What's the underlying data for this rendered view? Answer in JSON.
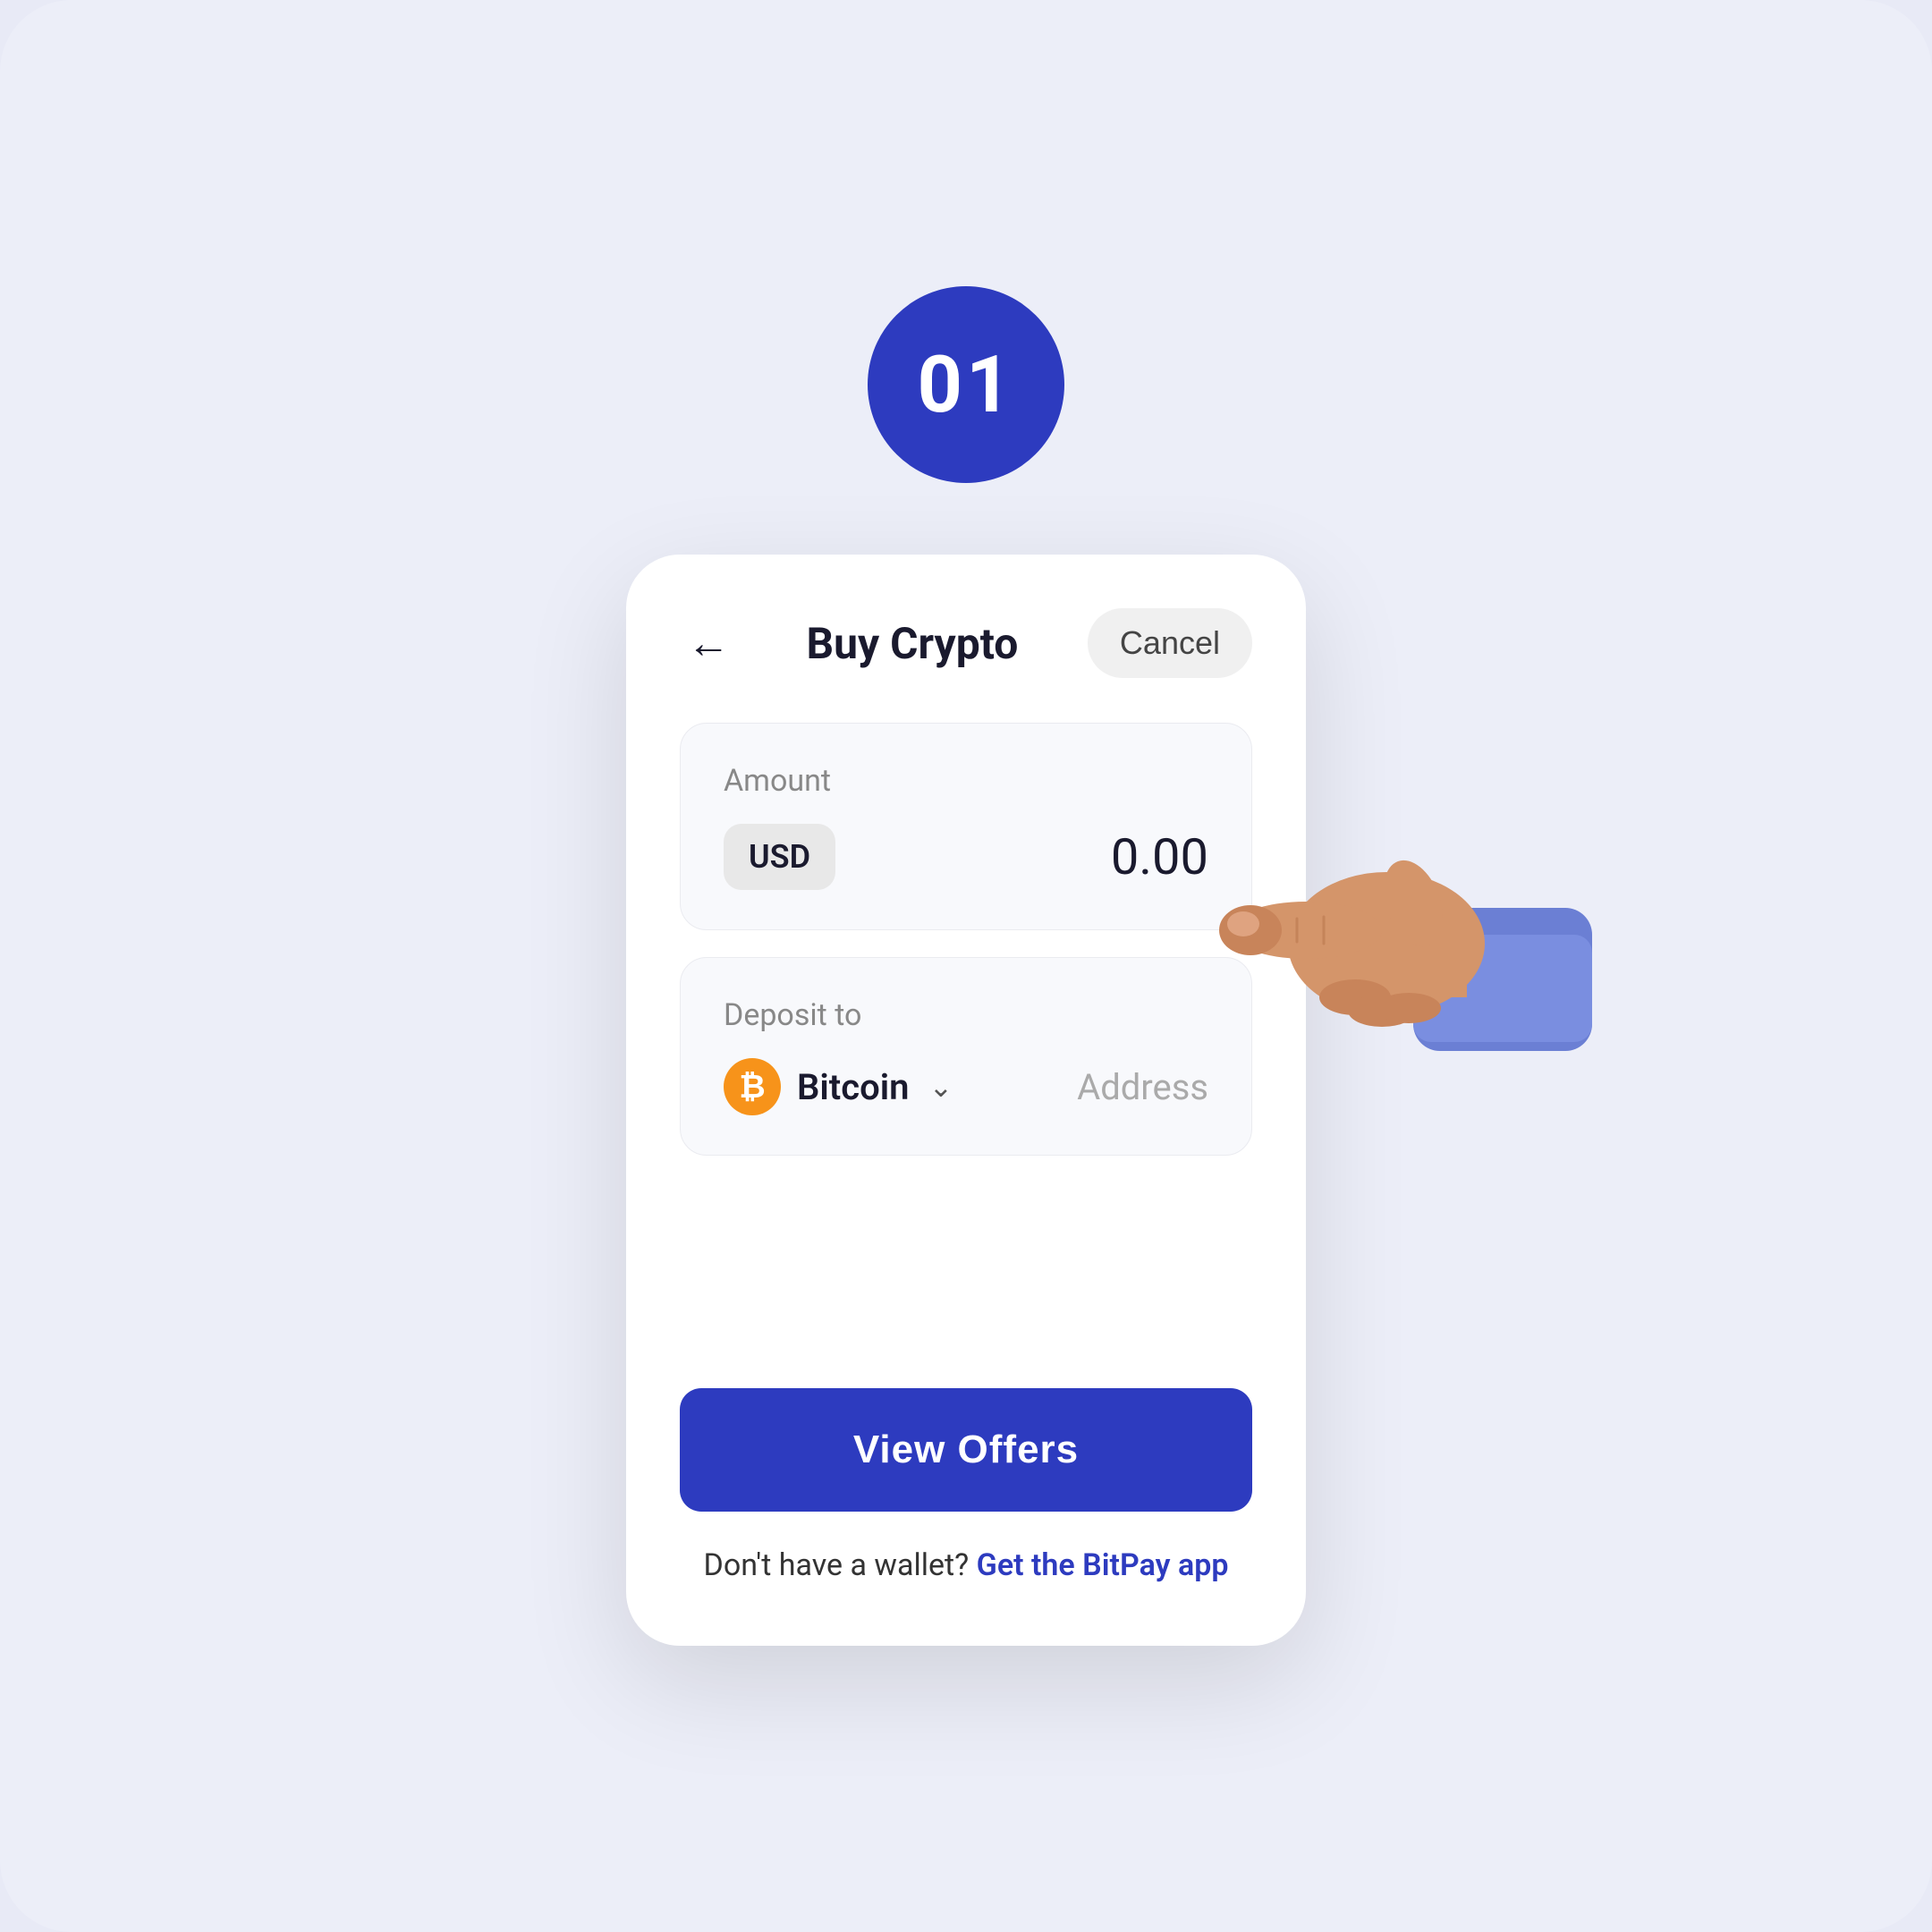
{
  "page": {
    "background_color": "#eceef8",
    "step_number": "01",
    "step_badge_color": "#2d3bbf"
  },
  "header": {
    "title": "Buy Crypto",
    "cancel_label": "Cancel",
    "back_icon": "←"
  },
  "amount_section": {
    "label": "Amount",
    "currency": "USD",
    "value": "0.00"
  },
  "deposit_section": {
    "label": "Deposit to",
    "crypto_name": "Bitcoin",
    "crypto_symbol": "₿",
    "address_placeholder": "Address"
  },
  "cta": {
    "view_offers_label": "View Offers",
    "wallet_text": "Don't have a wallet?",
    "wallet_link": "Get the BitPay app"
  },
  "icons": {
    "back": "←",
    "chevron_down": "⌄",
    "bitcoin": "₿"
  }
}
